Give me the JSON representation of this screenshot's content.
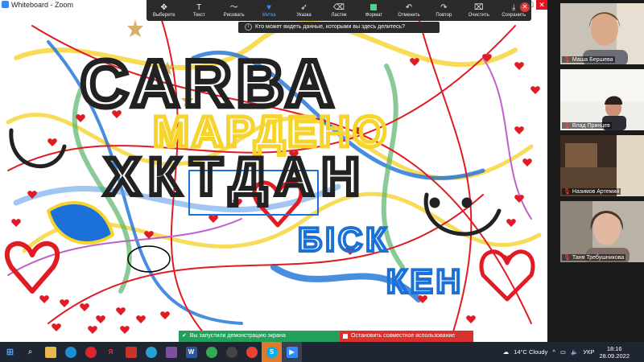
{
  "window": {
    "title": "Whiteboard - Zoom"
  },
  "toolbar": {
    "tools": [
      {
        "icon": "move-icon",
        "label": "Выберите"
      },
      {
        "icon": "text-icon",
        "label": "Текст"
      },
      {
        "icon": "draw-icon",
        "label": "Рисовать"
      },
      {
        "icon": "stamp-icon",
        "label": "Метка"
      },
      {
        "icon": "spotlight-icon",
        "label": "Указка"
      },
      {
        "icon": "eraser-icon",
        "label": "Ластик"
      },
      {
        "icon": "format-icon",
        "label": "Формат"
      },
      {
        "icon": "undo-icon",
        "label": "Отменить"
      },
      {
        "icon": "redo-icon",
        "label": "Повтор"
      },
      {
        "icon": "clear-icon",
        "label": "Очистить"
      },
      {
        "icon": "save-icon",
        "label": "Сохранить"
      }
    ],
    "active_tool": "Метка",
    "share_question": "Кто может видеть данные, которыми вы здесь делитесь?"
  },
  "participants": [
    {
      "name": "Маша Бершева"
    },
    {
      "name": "Влад Принцев"
    },
    {
      "name": "Назимов Артемий"
    },
    {
      "name": "Таня Требушникова"
    }
  ],
  "share_bar": {
    "status": "Вы запустили демонстрацию экрана",
    "stop": "Остановить совместное использование"
  },
  "canvas_text": [
    "САRВА",
    "МАРДЕНО",
    "ХКТДАН",
    "БІСК",
    "КЕН"
  ],
  "taskbar": {
    "weather": "14°C  Cloudy",
    "lang": "УКР",
    "time": "18:16",
    "date": "28.09.2022"
  },
  "colors": {
    "zoom_blue": "#2d8cff",
    "heart_red": "#e01b24",
    "toolbar_bg": "#2b2b2b",
    "share_green": "#23a05a",
    "share_red": "#d9322e"
  }
}
